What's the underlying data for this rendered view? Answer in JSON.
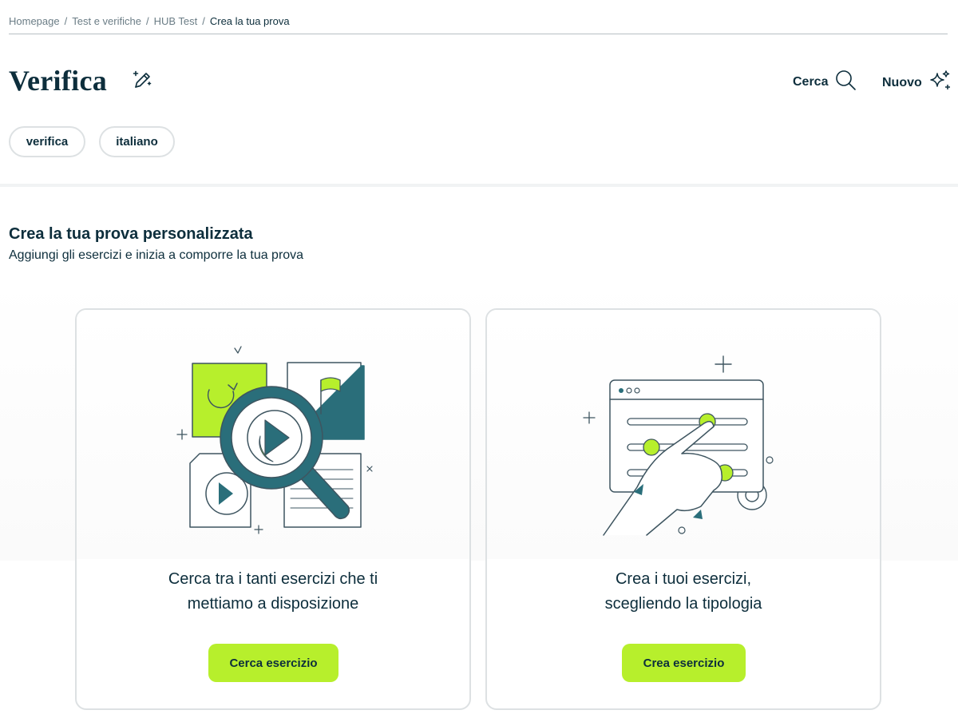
{
  "breadcrumb": {
    "items": [
      "Homepage",
      "Test e verifiche",
      "HUB Test"
    ],
    "current": "Crea la tua prova",
    "separator": "/"
  },
  "header": {
    "title": "Verifica",
    "search_label": "Cerca",
    "new_label": "Nuovo"
  },
  "tags": [
    "verifica",
    "italiano"
  ],
  "section": {
    "title": "Crea la tua prova personalizzata",
    "subtitle": "Aggiungi gli esercizi e inizia a comporre la tua prova"
  },
  "cards": [
    {
      "desc_lines": [
        "Cerca tra i tanti esercizi che ti",
        "mettiamo a disposizione"
      ],
      "button_label": "Cerca esercizio",
      "illustration": "magnifier-over-exercises-icon"
    },
    {
      "desc_lines": [
        "Crea i tuoi esercizi,",
        "scegliendo la tipologia"
      ],
      "button_label": "Crea esercizio",
      "illustration": "hand-adjusting-sliders-icon"
    }
  ],
  "colors": {
    "primary_text": "#0d2e3c",
    "accent_green": "#b7ef2c",
    "teal": "#2a6e7a",
    "border": "#dde1e3"
  }
}
